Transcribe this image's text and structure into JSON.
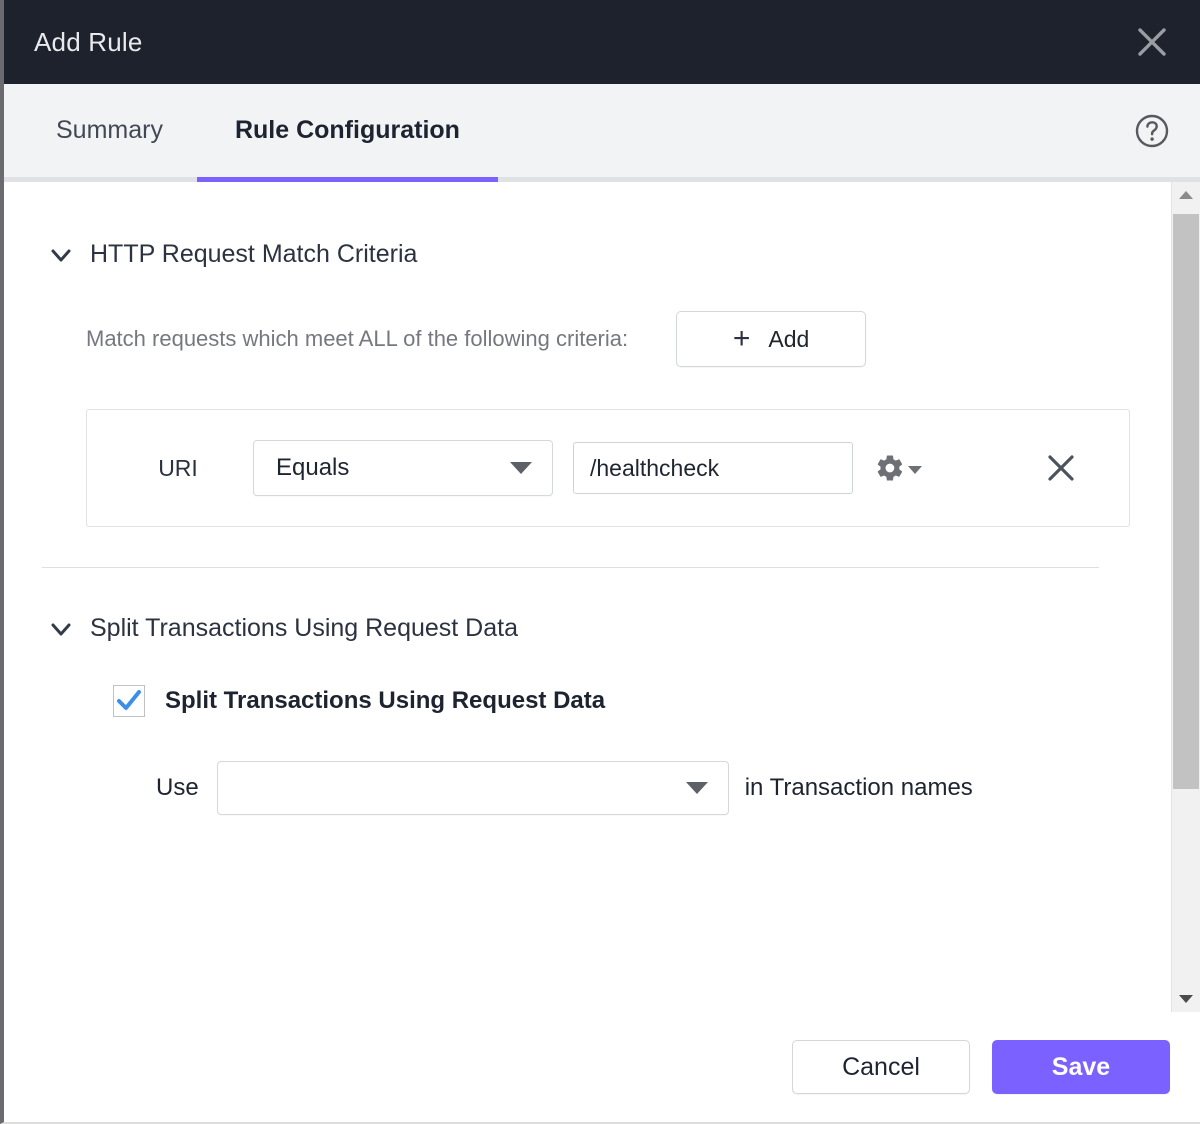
{
  "window": {
    "title": "Add Rule",
    "close_icon": "close-icon"
  },
  "tabs": {
    "items": [
      {
        "label": "Summary",
        "active": false
      },
      {
        "label": "Rule Configuration",
        "active": true
      }
    ],
    "help_icon": "help-circle-icon",
    "accent_color": "#7b61ff"
  },
  "sections": {
    "match_criteria": {
      "title": "HTTP Request Match Criteria",
      "chevron_icon": "chevron-down-icon",
      "description": "Match requests which meet ALL of the following criteria:",
      "add_button": {
        "label": "Add",
        "icon": "plus-icon"
      },
      "criteria_row": {
        "field_label": "URI",
        "operator_value": "Equals",
        "operator_caret_icon": "caret-down-icon",
        "value": "/healthcheck",
        "value_placeholder": "",
        "gear_icon": "gear-icon",
        "gear_caret_icon": "caret-down-icon",
        "remove_icon": "close-icon"
      }
    },
    "split_transactions": {
      "title": "Split Transactions Using Request Data",
      "chevron_icon": "chevron-down-icon",
      "checkbox": {
        "label": "Split Transactions Using Request Data",
        "checked": true,
        "check_color": "#3b8fe8"
      },
      "use_row": {
        "prefix_label": "Use",
        "select_value": "",
        "select_caret_icon": "caret-down-icon",
        "suffix_label": "in Transaction names"
      }
    }
  },
  "scrollbar": {
    "up_arrow_icon": "arrow-up-icon",
    "down_arrow_icon": "arrow-down-icon",
    "thumb": "scrollbar-thumb"
  },
  "footer": {
    "cancel_label": "Cancel",
    "save_label": "Save"
  },
  "colors": {
    "titlebar_bg": "#1d222c",
    "accent": "#7b61ff",
    "tabbar_bg": "#f2f3f5"
  }
}
